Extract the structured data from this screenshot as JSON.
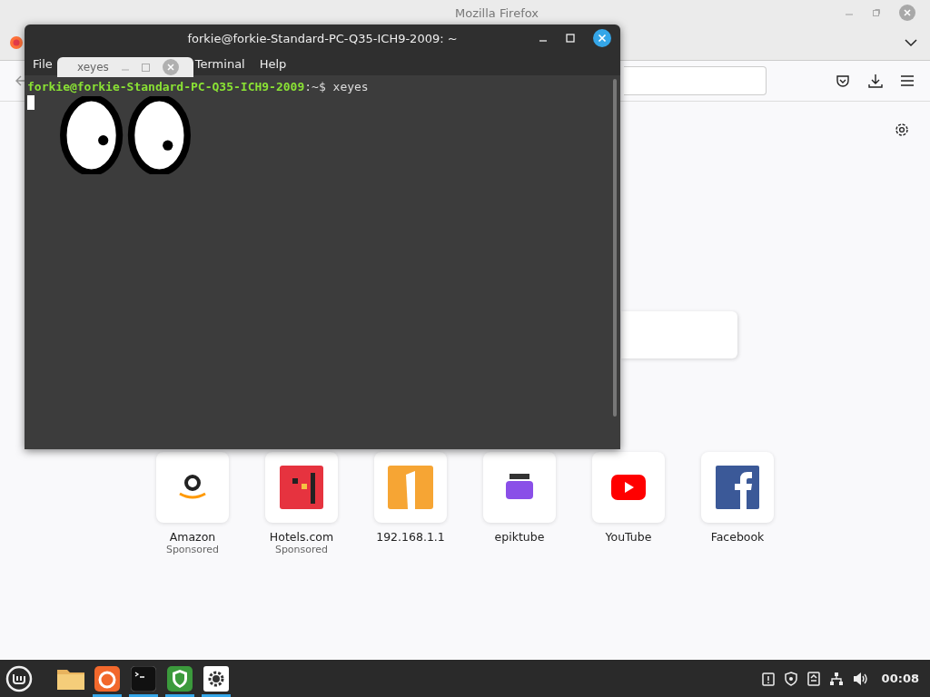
{
  "firefox": {
    "title": "Mozilla Firefox",
    "shortcuts": [
      {
        "label": "Amazon",
        "sponsor": "Sponsored",
        "kind": "amazon"
      },
      {
        "label": "Hotels.com",
        "sponsor": "Sponsored",
        "kind": "hotels"
      },
      {
        "label": "192.168.1.1",
        "kind": "orange"
      },
      {
        "label": "epiktube",
        "kind": "epik"
      },
      {
        "label": "YouTube",
        "kind": "youtube"
      },
      {
        "label": "Facebook",
        "kind": "facebook"
      }
    ]
  },
  "terminal": {
    "title": "forkie@forkie-Standard-PC-Q35-ICH9-2009: ~",
    "menu": [
      "File",
      "Terminal",
      "Help"
    ],
    "prompt_user": "forkie@forkie-Standard-PC-Q35-ICH9-2009",
    "prompt_path": ":~$",
    "command": "xeyes"
  },
  "xeyes": {
    "title": "xeyes"
  },
  "taskbar": {
    "apps": [
      {
        "kind": "folder",
        "active": false
      },
      {
        "kind": "firefox",
        "active": true
      },
      {
        "kind": "terminal",
        "active": true
      },
      {
        "kind": "shield",
        "active": true
      },
      {
        "kind": "settings",
        "active": true
      }
    ],
    "clock": "00:08"
  }
}
